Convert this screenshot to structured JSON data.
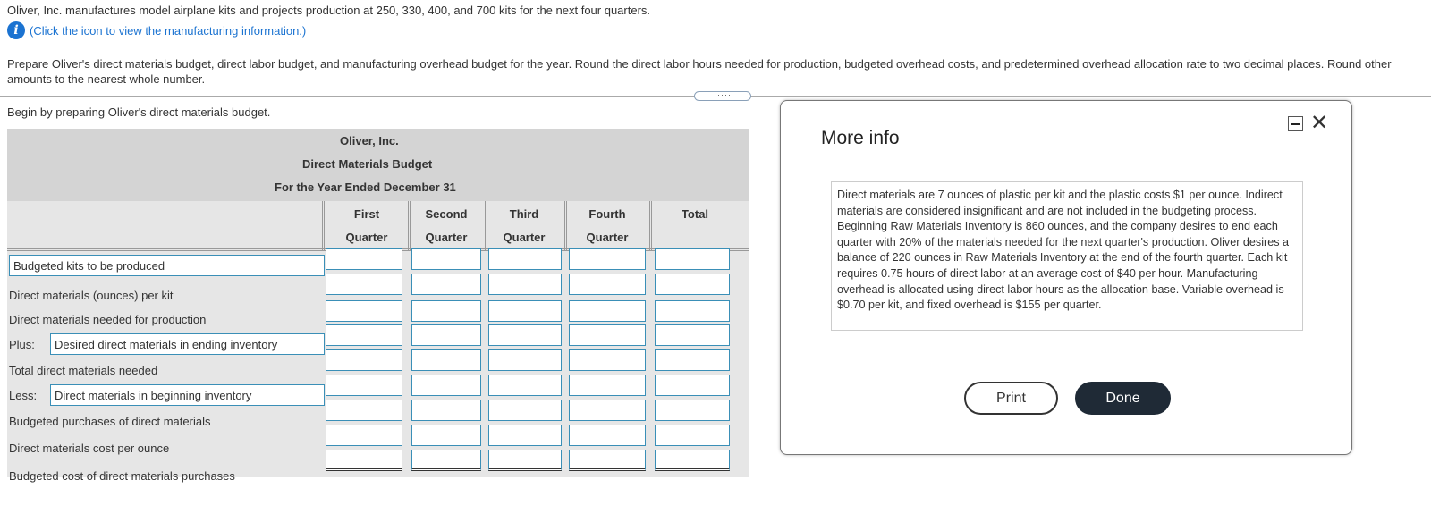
{
  "problem": "Oliver, Inc. manufactures model airplane kits and projects production at 250, 330, 400, and 700 kits for the next four quarters.",
  "info_link": "(Click the icon to view the manufacturing information.)",
  "instructions": "Prepare Oliver's direct materials budget, direct labor budget, and manufacturing overhead budget for the year. Round the direct labor hours needed for production, budgeted overhead costs, and predetermined overhead allocation rate to two decimal places. Round other amounts to the nearest whole number.",
  "handle": "·····",
  "begin": "Begin by preparing Oliver's direct materials budget.",
  "budget": {
    "company": "Oliver, Inc.",
    "name": "Direct Materials Budget",
    "period": "For the Year Ended December 31",
    "columns": [
      {
        "line1": "First",
        "line2": "Quarter"
      },
      {
        "line1": "Second",
        "line2": "Quarter"
      },
      {
        "line1": "Third",
        "line2": "Quarter"
      },
      {
        "line1": "Fourth",
        "line2": "Quarter"
      },
      {
        "line1": "",
        "line2": "Total"
      }
    ],
    "rows": {
      "r0": "Budgeted kits to be produced",
      "r1": "Direct materials (ounces) per kit",
      "r2": "Direct materials needed for production",
      "r3_prefix": "Plus:",
      "r3": "Desired direct materials in ending inventory",
      "r4": "Total direct materials needed",
      "r5_prefix": "Less:",
      "r5": "Direct materials in beginning inventory",
      "r6": "Budgeted purchases of direct materials",
      "r7": "Direct materials cost per ounce",
      "r8": "Budgeted cost of direct materials purchases"
    }
  },
  "modal": {
    "title": "More info",
    "close": "✕",
    "info": "Direct materials are 7 ounces of plastic per kit and the plastic costs $1 per ounce. Indirect materials are considered insignificant and are not included in the budgeting process. Beginning Raw Materials Inventory is 860 ounces, and the company desires to end each quarter with 20% of the materials needed for the next quarter's production. Oliver desires a balance of 220 ounces in Raw Materials Inventory at the end of the fourth quarter. Each kit requires 0.75 hours of direct labor at an average cost of $40 per hour. Manufacturing overhead is allocated using direct labor hours as the allocation base. Variable overhead is $0.70 per kit, and fixed overhead is $155 per quarter.",
    "print": "Print",
    "done": "Done"
  }
}
